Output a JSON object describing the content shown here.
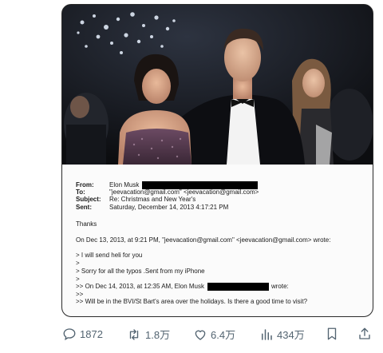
{
  "email": {
    "from_label": "From:",
    "from_value": "Elon Musk",
    "to_label": "To:",
    "to_value": "\"jeevacation@gmail.com\" <jeevacation@gmail.com>",
    "subject_label": "Subject:",
    "subject_value": "Re: Christmas and New Year's",
    "sent_label": "Sent:",
    "sent_value": "Saturday, December 14, 2013 4:17:21 PM",
    "greeting": "Thanks",
    "quote_header": "On Dec 13, 2013, at 9:21 PM, \"jeevacation@gmail.com\" <jeevacation@gmail.com> wrote:",
    "q1": "> I will send heli for you",
    "q2": ">",
    "q3": "> Sorry for all the typos .Sent from my iPhone",
    "q4": ">",
    "q5_prefix": ">> On Dec 14, 2013, at 12:35 AM, Elon Musk",
    "q5_suffix": "wrote:",
    "q6": ">>",
    "q7": ">> Will be in the BVI/St Bart's area over the holidays. Is there a good time to visit?"
  },
  "actions": {
    "reply_count": "1872",
    "repost_count": "1.8万",
    "like_count": "6.4万",
    "views_count": "434万"
  },
  "icons": {
    "reply": "reply-icon",
    "repost": "repost-icon",
    "like": "heart-icon",
    "views": "views-icon",
    "bookmark": "bookmark-icon",
    "share": "share-icon"
  },
  "colors": {
    "action_gray": "#536471",
    "redaction": "#000000"
  }
}
